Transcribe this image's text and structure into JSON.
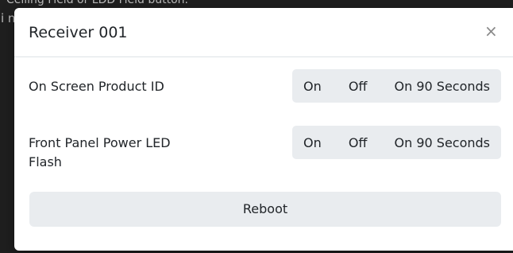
{
  "background": {
    "top_text": "Ceiling Field   or   LDD Field   button.",
    "left_glyphs": "i n"
  },
  "modal": {
    "title": "Receiver 001",
    "close_label": "×",
    "rows": [
      {
        "label": "On Screen Product ID",
        "options": [
          "On",
          "Off",
          "On 90 Seconds"
        ]
      },
      {
        "label": "Front Panel Power LED Flash",
        "options": [
          "On",
          "Off",
          "On 90 Seconds"
        ]
      }
    ],
    "reboot_label": "Reboot"
  },
  "colors": {
    "accent_bg": "#e9ecef",
    "text": "#212529",
    "backdrop": "#1f1f1f"
  }
}
